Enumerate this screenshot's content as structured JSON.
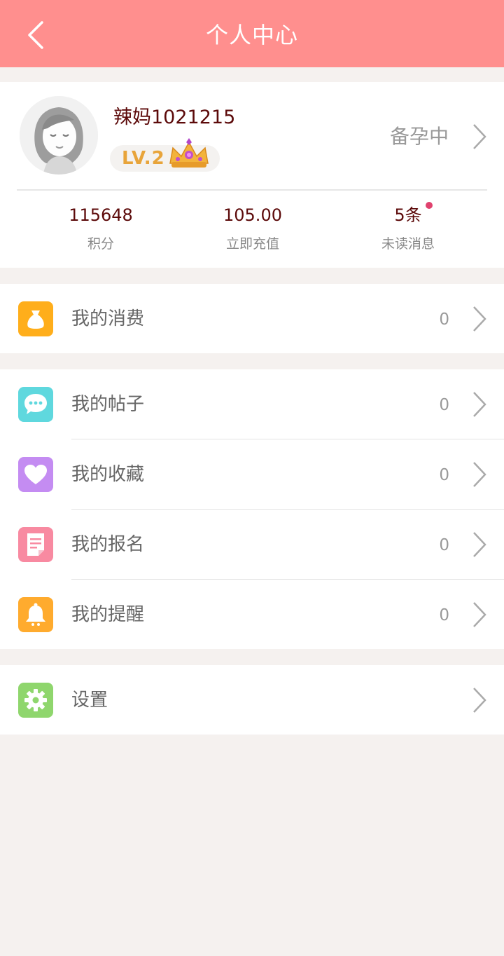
{
  "header": {
    "title": "个人中心",
    "back_icon": "chevron-left-icon",
    "background": "#ff8f8e"
  },
  "profile": {
    "username": "辣妈1021215",
    "level": "LV.2",
    "status": "备孕中",
    "stats": [
      {
        "value": "115648",
        "label": "积分"
      },
      {
        "value": "105.00",
        "label": "立即充值"
      },
      {
        "value": "5条",
        "label": "未读消息",
        "has_unread_dot": true
      }
    ]
  },
  "menu": {
    "consumption": {
      "label": "我的消费",
      "count": "0",
      "icon": "money-bag-icon",
      "color": "#ffae1b"
    },
    "posts": {
      "label": "我的帖子",
      "count": "0",
      "icon": "chat-bubble-icon",
      "color": "#5fd8de"
    },
    "favorites": {
      "label": "我的收藏",
      "count": "0",
      "icon": "heart-icon",
      "color": "#c48cf2"
    },
    "signups": {
      "label": "我的报名",
      "count": "0",
      "icon": "document-icon",
      "color": "#f88aa1"
    },
    "reminders": {
      "label": "我的提醒",
      "count": "0",
      "icon": "bell-icon",
      "color": "#ffab2e"
    },
    "settings": {
      "label": "设置",
      "icon": "gear-icon",
      "color": "#8fd66d"
    }
  }
}
